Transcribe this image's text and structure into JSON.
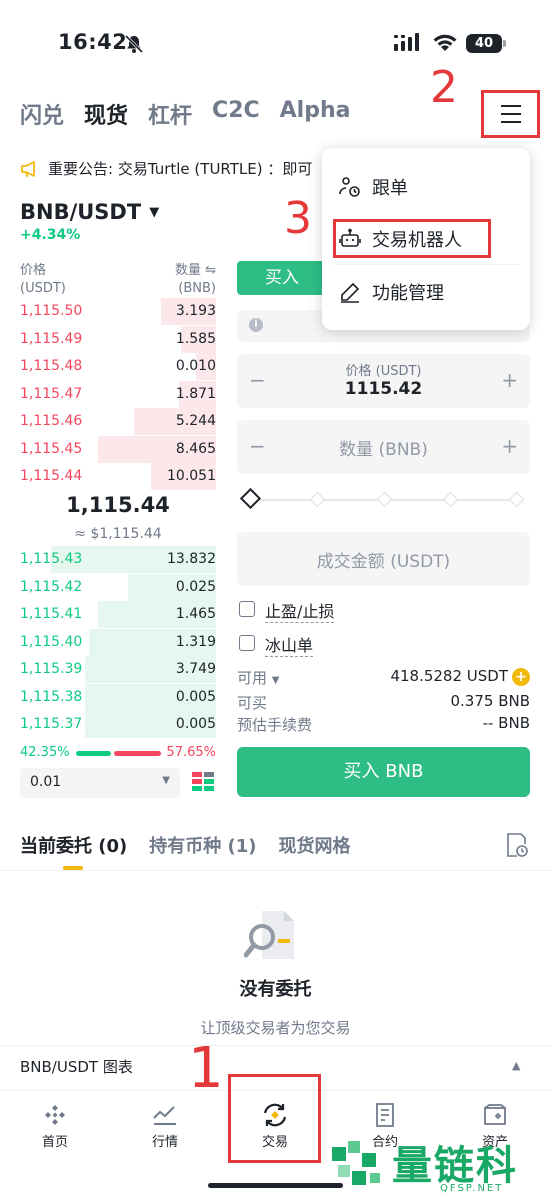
{
  "status": {
    "time": "16:42",
    "battery": "40"
  },
  "top_tabs": [
    "闪兑",
    "现货",
    "杠杆",
    "C2C",
    "Alpha"
  ],
  "active_top_tab": 1,
  "annotations": {
    "n1": "1",
    "n2": "2",
    "n3": "3"
  },
  "announcement": "重要公告: 交易Turtle (TURTLE) ：即可",
  "pair": {
    "symbol": "BNB/USDT",
    "change": "+4.34%"
  },
  "orderbook": {
    "price_header": "价格",
    "price_unit": "(USDT)",
    "qty_header": "数量 ⇋",
    "qty_unit": "(BNB)",
    "asks": [
      {
        "price": "1,115.50",
        "qty": "3.193",
        "depth": 0.28
      },
      {
        "price": "1,115.49",
        "qty": "1.585",
        "depth": 0.18
      },
      {
        "price": "1,115.48",
        "qty": "0.010",
        "depth": 0.1
      },
      {
        "price": "1,115.47",
        "qty": "1.871",
        "depth": 0.19
      },
      {
        "price": "1,115.46",
        "qty": "5.244",
        "depth": 0.42
      },
      {
        "price": "1,115.45",
        "qty": "8.465",
        "depth": 0.6
      },
      {
        "price": "1,115.44",
        "qty": "10.051",
        "depth": 0.33
      }
    ],
    "mid_price": "1,115.44",
    "mid_fiat": "≈ $1,115.44",
    "bids": [
      {
        "price": "1,115.43",
        "qty": "13.832",
        "depth": 0.84
      },
      {
        "price": "1,115.42",
        "qty": "0.025",
        "depth": 0.45
      },
      {
        "price": "1,115.41",
        "qty": "1.465",
        "depth": 0.6
      },
      {
        "price": "1,115.40",
        "qty": "1.319",
        "depth": 0.65
      },
      {
        "price": "1,115.39",
        "qty": "3.749",
        "depth": 0.67
      },
      {
        "price": "1,115.38",
        "qty": "0.005",
        "depth": 0.67
      },
      {
        "price": "1,115.37",
        "qty": "0.005",
        "depth": 0.67
      }
    ],
    "buy_ratio": "42.35%",
    "sell_ratio": "57.65%",
    "depth_value": "0.01"
  },
  "order_form": {
    "buy_tab": "买入",
    "price_label": "价格 (USDT)",
    "price_value": "1115.42",
    "qty_placeholder": "数量 (BNB)",
    "total_placeholder": "成交金额 (USDT)",
    "tp_sl": "止盈/止损",
    "iceberg": "冰山单",
    "available_label": "可用",
    "available_value": "418.5282 USDT",
    "can_buy_label": "可买",
    "can_buy_value": "0.375 BNB",
    "fee_label": "预估手续费",
    "fee_value": "-- BNB",
    "buy_button": "买入 BNB"
  },
  "dropdown_menu": {
    "items": [
      "跟单",
      "交易机器人",
      "功能管理"
    ]
  },
  "orders": {
    "tabs": [
      "当前委托 (0)",
      "持有币种 (1)",
      "现货网格"
    ],
    "empty_title": "没有委托",
    "empty_sub": "让顶级交易者为您交易"
  },
  "chart_bar": "BNB/USDT 图表",
  "bottom_nav": [
    "首页",
    "行情",
    "交易",
    "合约",
    "资产"
  ],
  "watermark": {
    "text": "量链科技",
    "sub": "QFSP.NET"
  },
  "colors": {
    "green": "#0ecb81",
    "red": "#f6465d",
    "brand": "#f0b90b",
    "annotation": "#e5383b"
  }
}
